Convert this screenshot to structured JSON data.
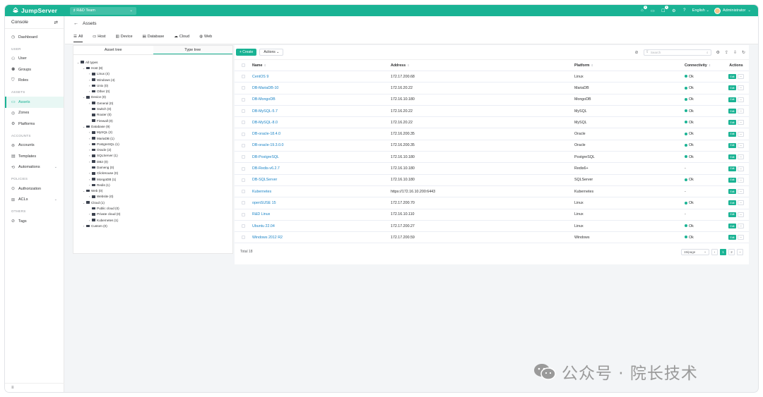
{
  "topbar": {
    "brand": "JumpServer",
    "org": "R&D Team",
    "badges": [
      "1",
      "1"
    ],
    "language": "English",
    "user": "Administrator"
  },
  "sidebar": {
    "console": "Console",
    "sections": [
      {
        "title": "USER",
        "items": [
          {
            "label": "User",
            "icon": "user-icon"
          },
          {
            "label": "Groups",
            "icon": "groups-icon"
          },
          {
            "label": "Roles",
            "icon": "shield-icon"
          }
        ]
      },
      {
        "title": "ASSETS",
        "items": [
          {
            "label": "Assets",
            "icon": "monitor-icon"
          },
          {
            "label": "Zones",
            "icon": "zones-icon"
          },
          {
            "label": "Platforms",
            "icon": "platforms-icon"
          }
        ]
      },
      {
        "title": "ACCOUNTS",
        "items": [
          {
            "label": "Accounts",
            "icon": "accounts-icon"
          },
          {
            "label": "Templates",
            "icon": "templates-icon"
          },
          {
            "label": "Automations",
            "icon": "automations-icon"
          }
        ]
      },
      {
        "title": "POLICIES",
        "items": [
          {
            "label": "Authorization",
            "icon": "authorization-icon"
          },
          {
            "label": "ACLs",
            "icon": "acls-icon"
          }
        ]
      },
      {
        "title": "OTHERS",
        "items": [
          {
            "label": "Tags",
            "icon": "tag-icon"
          }
        ]
      }
    ],
    "dashboard": "Dashboard"
  },
  "page": {
    "title": "Assets",
    "tabs": [
      "All",
      "Host",
      "Device",
      "Database",
      "Cloud",
      "Web"
    ]
  },
  "tree": {
    "tabs": [
      "Asset tree",
      "Type tree"
    ],
    "nodes": [
      {
        "label": "All types",
        "level": 0,
        "toggle": "expanded"
      },
      {
        "label": "Host (8)",
        "level": 1,
        "toggle": "expanded"
      },
      {
        "label": "Linux (4)",
        "level": 2,
        "toggle": "collapsed"
      },
      {
        "label": "Windows (4)",
        "level": 2,
        "toggle": "collapsed"
      },
      {
        "label": "Unix (0)",
        "level": 2,
        "toggle": "collapsed"
      },
      {
        "label": "Other (0)",
        "level": 2,
        "toggle": "collapsed"
      },
      {
        "label": "Device (0)",
        "level": 1,
        "toggle": "expanded"
      },
      {
        "label": "General (0)",
        "level": 2,
        "toggle": "collapsed"
      },
      {
        "label": "Switch (0)",
        "level": 2,
        "toggle": "none"
      },
      {
        "label": "Router (0)",
        "level": 2,
        "toggle": "none"
      },
      {
        "label": "Firewall (0)",
        "level": 2,
        "toggle": "none"
      },
      {
        "label": "Database (9)",
        "level": 1,
        "toggle": "expanded"
      },
      {
        "label": "MySQL (2)",
        "level": 2,
        "toggle": "collapsed"
      },
      {
        "label": "MariaDB (1)",
        "level": 2,
        "toggle": "collapsed"
      },
      {
        "label": "PostgreSQL (1)",
        "level": 2,
        "toggle": "collapsed"
      },
      {
        "label": "Oracle (2)",
        "level": 2,
        "toggle": "collapsed"
      },
      {
        "label": "SQLServer (1)",
        "level": 2,
        "toggle": "collapsed"
      },
      {
        "label": "DB2 (0)",
        "level": 2,
        "toggle": "collapsed"
      },
      {
        "label": "Dameng (0)",
        "level": 2,
        "toggle": "none"
      },
      {
        "label": "ClickHouse (0)",
        "level": 2,
        "toggle": "collapsed"
      },
      {
        "label": "MongoDB (1)",
        "level": 2,
        "toggle": "collapsed"
      },
      {
        "label": "Redis (1)",
        "level": 2,
        "toggle": "collapsed"
      },
      {
        "label": "Web (0)",
        "level": 1,
        "toggle": "expanded"
      },
      {
        "label": "Website (0)",
        "level": 2,
        "toggle": "collapsed"
      },
      {
        "label": "Cloud (1)",
        "level": 1,
        "toggle": "expanded"
      },
      {
        "label": "Public cloud (0)",
        "level": 2,
        "toggle": "none"
      },
      {
        "label": "Private cloud (0)",
        "level": 2,
        "toggle": "collapsed"
      },
      {
        "label": "Kubernetes (1)",
        "level": 2,
        "toggle": "collapsed"
      },
      {
        "label": "Custom (0)",
        "level": 1,
        "toggle": "collapsed"
      }
    ]
  },
  "toolbar": {
    "create": "+ Create",
    "actions": "Actions",
    "search_placeholder": "Search"
  },
  "table": {
    "headers": [
      "Name",
      "Address",
      "Platform",
      "Connectivity",
      "Actions"
    ],
    "edit_label": "Edit",
    "more_label": "···",
    "rows": [
      {
        "name": "CentOS 9",
        "address": "172.17.200.68",
        "platform": "Linux",
        "conn": "Ok"
      },
      {
        "name": "DB-MariaDB-10",
        "address": "172.16.20.22",
        "platform": "MariaDB",
        "conn": "Ok"
      },
      {
        "name": "DB-MongoDB",
        "address": "172.16.10.180",
        "platform": "MongoDB",
        "conn": "Ok"
      },
      {
        "name": "DB-MySQL-5.7",
        "address": "172.16.20.22",
        "platform": "MySQL",
        "conn": "Ok"
      },
      {
        "name": "DB-MySQL-8.0",
        "address": "172.16.20.22",
        "platform": "MySQL",
        "conn": "Ok"
      },
      {
        "name": "DB-oracle-18.4.0",
        "address": "172.16.200.35",
        "platform": "Oracle",
        "conn": "Ok"
      },
      {
        "name": "DB-oracle-19.3.0.0",
        "address": "172.16.200.35",
        "platform": "Oracle",
        "conn": "Ok"
      },
      {
        "name": "DB-PostgreSQL",
        "address": "172.16.10.180",
        "platform": "PostgreSQL",
        "conn": "Ok"
      },
      {
        "name": "DB-Redis-v6.2.7",
        "address": "172.16.10.180",
        "platform": "Redis6+",
        "conn": "-"
      },
      {
        "name": "DB-SQLServer",
        "address": "172.16.10.180",
        "platform": "SQLServer",
        "conn": "Ok"
      },
      {
        "name": "Kubernetes",
        "address": "https://172.16.10.200:6443",
        "platform": "Kubernetes",
        "conn": "-"
      },
      {
        "name": "openSUSE 15",
        "address": "172.17.200.70",
        "platform": "Linux",
        "conn": "Ok"
      },
      {
        "name": "R&D Linux",
        "address": "172.16.10.110",
        "platform": "Linux",
        "conn": "-"
      },
      {
        "name": "Ubuntu 22.04",
        "address": "172.17.200.27",
        "platform": "Linux",
        "conn": "Ok"
      },
      {
        "name": "Windows 2012 R2",
        "address": "172.17.200.59",
        "platform": "Windows",
        "conn": "Ok"
      }
    ],
    "total": "Total 18",
    "page_size": "15/page",
    "pages": [
      "1",
      "2"
    ],
    "current_page": "1"
  },
  "watermark": {
    "text": "公众号 · 院长技术"
  },
  "colors": {
    "accent": "#1ab394",
    "link": "#1c84c6"
  }
}
